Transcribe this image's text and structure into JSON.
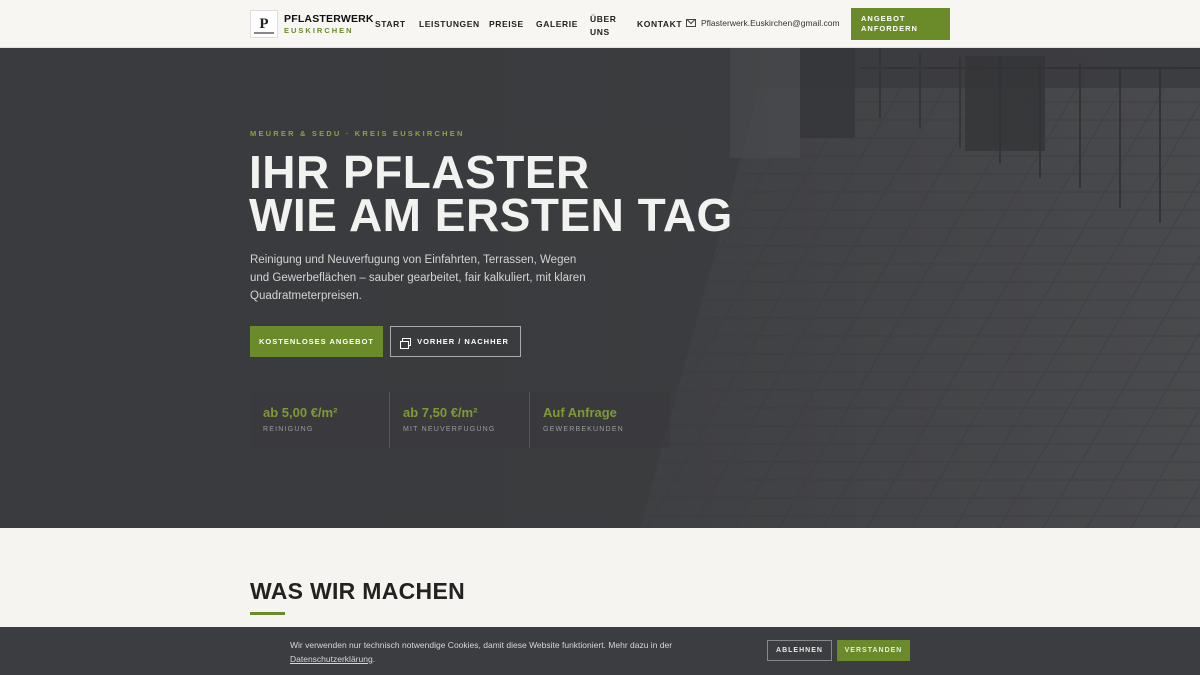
{
  "header": {
    "logo_title": "PFLASTERWERK",
    "logo_sub": "EUSKIRCHEN",
    "nav": [
      "START",
      "LEISTUNGEN",
      "PREISE",
      "GALERIE",
      "ÜBER UNS",
      "KONTAKT"
    ],
    "email": "Pflasterwerk.Euskirchen@gmail.com",
    "cta": "ANGEBOT ANFORDERN"
  },
  "hero": {
    "eyebrow": "MEURER & SEDU · KREIS EUSKIRCHEN",
    "headline_line1": "IHR PFLASTER",
    "headline_line2": "WIE AM ERSTEN TAG",
    "lead": "Reinigung und Neuverfugung von Einfahrten, Terrassen, Wegen und Gewerbeflächen – sauber gearbeitet, fair kalkuliert, mit klaren Quadratmeterpreisen.",
    "btn_primary": "KOSTENLOSES ANGEBOT",
    "btn_secondary": "VORHER / NACHHER",
    "stats": [
      {
        "value": "ab 5,00 €/m²",
        "label": "REINIGUNG"
      },
      {
        "value": "ab 7,50 €/m²",
        "label": "MIT NEUVERFUGUNG"
      },
      {
        "value": "Auf Anfrage",
        "label": "GEWERBEKUNDEN"
      }
    ]
  },
  "section": {
    "title": "WAS WIR MACHEN"
  },
  "cookie": {
    "text": "Wir verwenden nur technisch notwendige Cookies, damit diese Website funktioniert. Mehr dazu in der",
    "link": "Datenschutzerklärung",
    "link_suffix": ".",
    "reject": "ABLEHNEN",
    "accept": "VERSTANDEN"
  },
  "colors": {
    "accent": "#6b8a2a",
    "hero_bg": "#3a3b3e",
    "page_bg": "#f5f4f0"
  },
  "icons": [
    "mail-icon",
    "gallery-icon"
  ]
}
